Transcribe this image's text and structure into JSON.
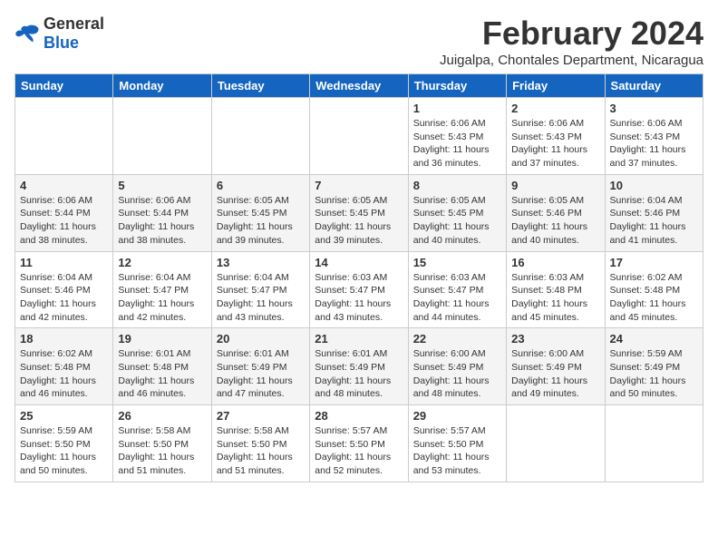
{
  "logo": {
    "general": "General",
    "blue": "Blue"
  },
  "header": {
    "title": "February 2024",
    "subtitle": "Juigalpa, Chontales Department, Nicaragua"
  },
  "weekdays": [
    "Sunday",
    "Monday",
    "Tuesday",
    "Wednesday",
    "Thursday",
    "Friday",
    "Saturday"
  ],
  "weeks": [
    [
      {
        "day": "",
        "info": ""
      },
      {
        "day": "",
        "info": ""
      },
      {
        "day": "",
        "info": ""
      },
      {
        "day": "",
        "info": ""
      },
      {
        "day": "1",
        "info": "Sunrise: 6:06 AM\nSunset: 5:43 PM\nDaylight: 11 hours and 36 minutes."
      },
      {
        "day": "2",
        "info": "Sunrise: 6:06 AM\nSunset: 5:43 PM\nDaylight: 11 hours and 37 minutes."
      },
      {
        "day": "3",
        "info": "Sunrise: 6:06 AM\nSunset: 5:43 PM\nDaylight: 11 hours and 37 minutes."
      }
    ],
    [
      {
        "day": "4",
        "info": "Sunrise: 6:06 AM\nSunset: 5:44 PM\nDaylight: 11 hours and 38 minutes."
      },
      {
        "day": "5",
        "info": "Sunrise: 6:06 AM\nSunset: 5:44 PM\nDaylight: 11 hours and 38 minutes."
      },
      {
        "day": "6",
        "info": "Sunrise: 6:05 AM\nSunset: 5:45 PM\nDaylight: 11 hours and 39 minutes."
      },
      {
        "day": "7",
        "info": "Sunrise: 6:05 AM\nSunset: 5:45 PM\nDaylight: 11 hours and 39 minutes."
      },
      {
        "day": "8",
        "info": "Sunrise: 6:05 AM\nSunset: 5:45 PM\nDaylight: 11 hours and 40 minutes."
      },
      {
        "day": "9",
        "info": "Sunrise: 6:05 AM\nSunset: 5:46 PM\nDaylight: 11 hours and 40 minutes."
      },
      {
        "day": "10",
        "info": "Sunrise: 6:04 AM\nSunset: 5:46 PM\nDaylight: 11 hours and 41 minutes."
      }
    ],
    [
      {
        "day": "11",
        "info": "Sunrise: 6:04 AM\nSunset: 5:46 PM\nDaylight: 11 hours and 42 minutes."
      },
      {
        "day": "12",
        "info": "Sunrise: 6:04 AM\nSunset: 5:47 PM\nDaylight: 11 hours and 42 minutes."
      },
      {
        "day": "13",
        "info": "Sunrise: 6:04 AM\nSunset: 5:47 PM\nDaylight: 11 hours and 43 minutes."
      },
      {
        "day": "14",
        "info": "Sunrise: 6:03 AM\nSunset: 5:47 PM\nDaylight: 11 hours and 43 minutes."
      },
      {
        "day": "15",
        "info": "Sunrise: 6:03 AM\nSunset: 5:47 PM\nDaylight: 11 hours and 44 minutes."
      },
      {
        "day": "16",
        "info": "Sunrise: 6:03 AM\nSunset: 5:48 PM\nDaylight: 11 hours and 45 minutes."
      },
      {
        "day": "17",
        "info": "Sunrise: 6:02 AM\nSunset: 5:48 PM\nDaylight: 11 hours and 45 minutes."
      }
    ],
    [
      {
        "day": "18",
        "info": "Sunrise: 6:02 AM\nSunset: 5:48 PM\nDaylight: 11 hours and 46 minutes."
      },
      {
        "day": "19",
        "info": "Sunrise: 6:01 AM\nSunset: 5:48 PM\nDaylight: 11 hours and 46 minutes."
      },
      {
        "day": "20",
        "info": "Sunrise: 6:01 AM\nSunset: 5:49 PM\nDaylight: 11 hours and 47 minutes."
      },
      {
        "day": "21",
        "info": "Sunrise: 6:01 AM\nSunset: 5:49 PM\nDaylight: 11 hours and 48 minutes."
      },
      {
        "day": "22",
        "info": "Sunrise: 6:00 AM\nSunset: 5:49 PM\nDaylight: 11 hours and 48 minutes."
      },
      {
        "day": "23",
        "info": "Sunrise: 6:00 AM\nSunset: 5:49 PM\nDaylight: 11 hours and 49 minutes."
      },
      {
        "day": "24",
        "info": "Sunrise: 5:59 AM\nSunset: 5:49 PM\nDaylight: 11 hours and 50 minutes."
      }
    ],
    [
      {
        "day": "25",
        "info": "Sunrise: 5:59 AM\nSunset: 5:50 PM\nDaylight: 11 hours and 50 minutes."
      },
      {
        "day": "26",
        "info": "Sunrise: 5:58 AM\nSunset: 5:50 PM\nDaylight: 11 hours and 51 minutes."
      },
      {
        "day": "27",
        "info": "Sunrise: 5:58 AM\nSunset: 5:50 PM\nDaylight: 11 hours and 51 minutes."
      },
      {
        "day": "28",
        "info": "Sunrise: 5:57 AM\nSunset: 5:50 PM\nDaylight: 11 hours and 52 minutes."
      },
      {
        "day": "29",
        "info": "Sunrise: 5:57 AM\nSunset: 5:50 PM\nDaylight: 11 hours and 53 minutes."
      },
      {
        "day": "",
        "info": ""
      },
      {
        "day": "",
        "info": ""
      }
    ]
  ]
}
